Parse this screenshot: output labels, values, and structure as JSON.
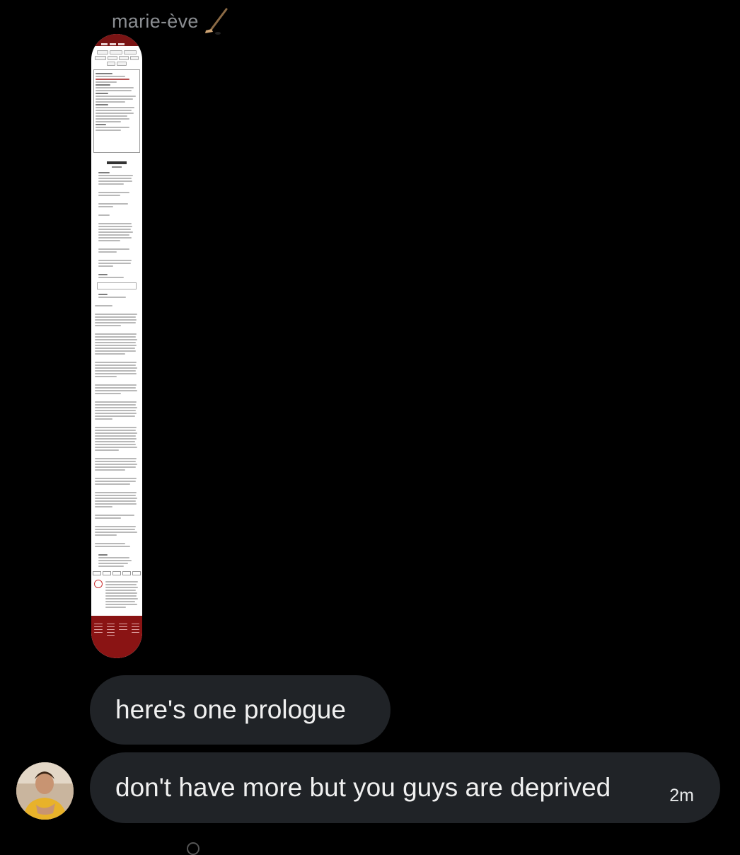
{
  "conversation": {
    "sender_name": "marie-ève",
    "sender_name_icon": "hockey-stick-icon"
  },
  "attachment": {
    "type": "image",
    "icon": "screenshot-thumbnail"
  },
  "messages": [
    {
      "text": "here's one prologue"
    },
    {
      "text": "don't have more but you guys are deprived",
      "timestamp": "2m"
    }
  ],
  "avatar": {
    "icon": "user-avatar"
  },
  "colors": {
    "background": "#000000",
    "bubble": "#202327",
    "text": "#f0f0f0",
    "name": "#8b8e92",
    "attachment_accent": "#8a1414"
  }
}
